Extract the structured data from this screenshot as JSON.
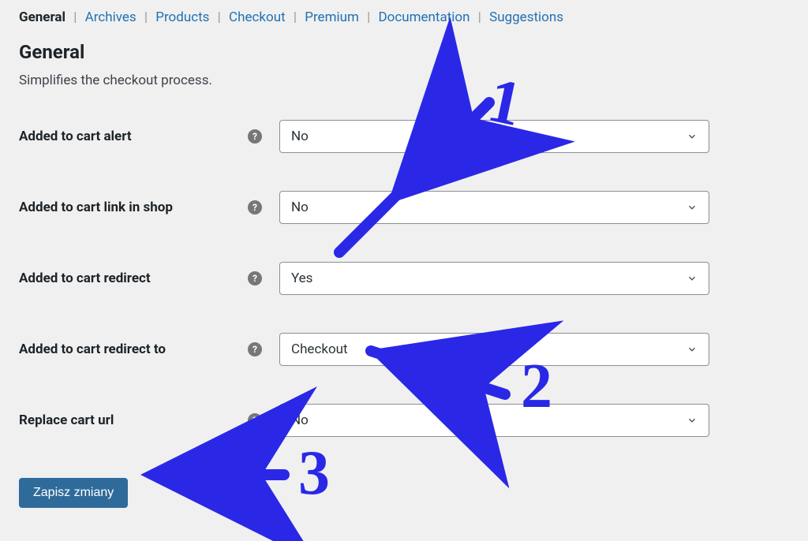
{
  "tabs": {
    "items": [
      {
        "label": "General",
        "active": true
      },
      {
        "label": "Archives",
        "active": false
      },
      {
        "label": "Products",
        "active": false
      },
      {
        "label": "Checkout",
        "active": false
      },
      {
        "label": "Premium",
        "active": false
      },
      {
        "label": "Documentation",
        "active": false
      },
      {
        "label": "Suggestions",
        "active": false
      }
    ]
  },
  "section": {
    "title": "General",
    "description": "Simplifies the checkout process."
  },
  "fields": {
    "added_to_cart_alert": {
      "label": "Added to cart alert",
      "value": "No"
    },
    "added_to_cart_link": {
      "label": "Added to cart link in shop",
      "value": "No"
    },
    "added_to_cart_redirect": {
      "label": "Added to cart redirect",
      "value": "Yes"
    },
    "added_to_cart_redirect_to": {
      "label": "Added to cart redirect to",
      "value": "Checkout"
    },
    "replace_cart_url": {
      "label": "Replace cart url",
      "value": "No"
    }
  },
  "buttons": {
    "save": "Zapisz zmiany"
  },
  "annotations": {
    "n1": "1",
    "n2": "2",
    "n3": "3"
  }
}
